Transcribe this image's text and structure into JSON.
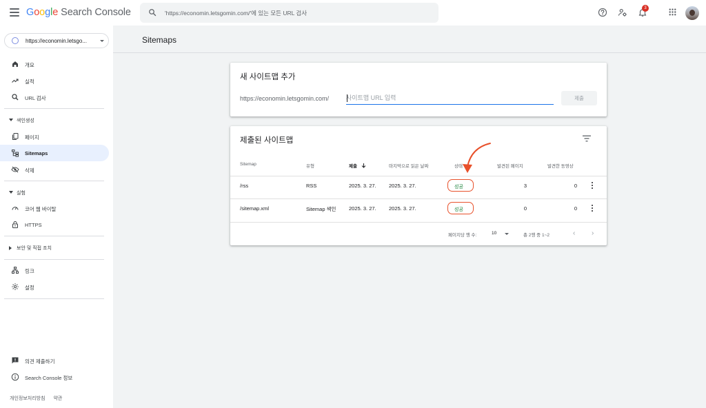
{
  "header": {
    "logo": {
      "g": "G",
      "o1": "o",
      "o2": "o",
      "g2": "g",
      "l": "l",
      "e": "e",
      "product": "Search Console"
    },
    "search_placeholder": "'https://economin.letsgomin.com/'에 있는 모든 URL 검사",
    "notification_count": "3",
    "icons": [
      "menu-icon",
      "search-icon",
      "help-icon",
      "manage-users-icon",
      "notifications-icon",
      "apps-icon"
    ]
  },
  "sidebar": {
    "property": "https://economin.letsgo...",
    "items_top": [
      {
        "label": "개요",
        "icon": "home-icon"
      },
      {
        "label": "실적",
        "icon": "trending-up-icon"
      },
      {
        "label": "URL 검사",
        "icon": "search-icon"
      }
    ],
    "section_indexing": "색인생성",
    "items_indexing": [
      {
        "label": "페이지",
        "icon": "pages-icon"
      },
      {
        "label": "Sitemaps",
        "icon": "sitemap-icon",
        "active": true
      },
      {
        "label": "삭제",
        "icon": "visibility-off-icon"
      }
    ],
    "section_experience": "실험",
    "items_experience": [
      {
        "label": "코어 웹 바이탈",
        "icon": "speed-icon"
      },
      {
        "label": "HTTPS",
        "icon": "lock-icon"
      }
    ],
    "section_security": "보안 및 직접 조치",
    "items_bottom": [
      {
        "label": "링크",
        "icon": "links-icon"
      },
      {
        "label": "설정",
        "icon": "settings-icon"
      }
    ],
    "items_footer": [
      {
        "label": "의견 제출하기",
        "icon": "feedback-icon"
      },
      {
        "label": "Search Console 정보",
        "icon": "info-icon"
      }
    ],
    "footer_links": [
      "개인정보처리방침",
      "약관"
    ]
  },
  "main": {
    "page_title": "Sitemaps",
    "add_card": {
      "title": "새 사이트맵 추가",
      "url_prefix": "https://economin.letsgomin.com/",
      "input_placeholder": "사이트맵 URL 입력",
      "submit_label": "제출"
    },
    "submitted_card": {
      "title": "제출된 사이트맵",
      "columns": [
        "Sitemap",
        "유형",
        "제출",
        "마지막으로 읽은 날짜",
        "상태",
        "발견된 페이지",
        "발견한 동영상"
      ],
      "rows": [
        {
          "sitemap": "/rss",
          "type": "RSS",
          "submitted": "2025. 3. 27.",
          "last_read": "2025. 3. 27.",
          "status": "성공",
          "pages": "3",
          "videos": "0"
        },
        {
          "sitemap": "/sitemap.xml",
          "type": "Sitemap 색인",
          "submitted": "2025. 3. 27.",
          "last_read": "2025. 3. 27.",
          "status": "성공",
          "pages": "0",
          "videos": "0"
        }
      ],
      "pagination": {
        "rows_per_page_label": "페이지당 행 수:",
        "rows_per_page": "10",
        "range": "총 2행 중 1~2"
      }
    }
  },
  "colors": {
    "accent": "#1a73e8",
    "success": "#188038",
    "annotation": "#e8502a",
    "active_nav": "#e8f0fe"
  }
}
